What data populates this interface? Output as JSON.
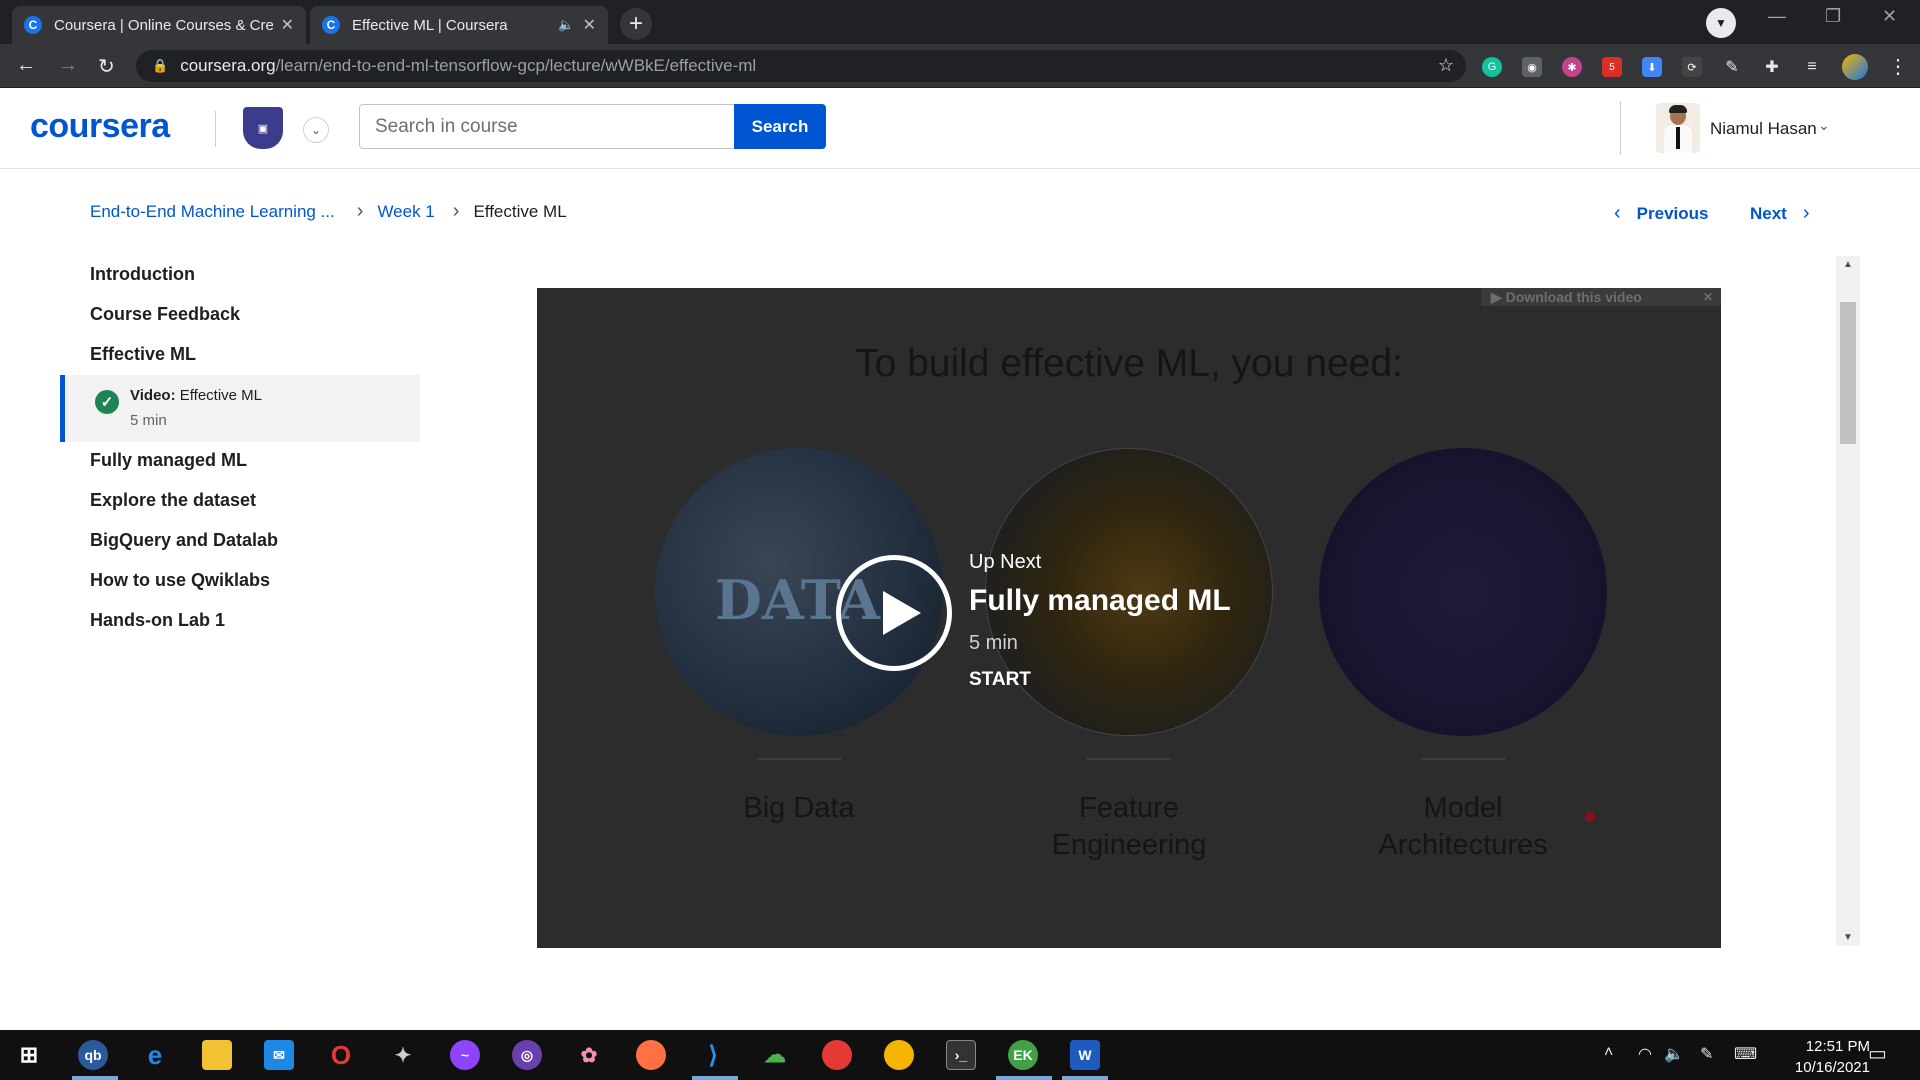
{
  "browser": {
    "tabs": [
      {
        "label": "Coursera | Online Courses & Credentials",
        "favicon": "C"
      },
      {
        "label": "Effective ML | Coursera",
        "favicon": "C"
      }
    ],
    "url_host": "coursera.org",
    "url_path": "/learn/end-to-end-ml-tensorflow-gcp/lecture/wWBkE/effective-ml",
    "extension_badge": "5"
  },
  "header": {
    "logo": "coursera",
    "search_placeholder": "Search in course",
    "search_button": "Search",
    "username": "Niamul Hasan"
  },
  "breadcrumb": {
    "course": "End-to-End Machine Learning ...",
    "week": "Week 1",
    "current": "Effective ML",
    "previous": "Previous",
    "next": "Next"
  },
  "sidebar": {
    "items": [
      "Introduction",
      "Course Feedback",
      "Effective ML",
      "Fully managed ML",
      "Explore the dataset",
      "BigQuery and Datalab",
      "How to use Qwiklabs",
      "Hands-on Lab 1"
    ],
    "active_item": {
      "type_label": "Video:",
      "title": "Effective ML",
      "duration": "5 min"
    }
  },
  "video": {
    "download_label": "Download this video",
    "slide_title": "To build effective ML, you need:",
    "circle_text": "DATA",
    "captions": [
      {
        "line1": "Big Data",
        "line2": ""
      },
      {
        "line1": "Feature",
        "line2": "Engineering"
      },
      {
        "line1": "Model",
        "line2": "Architectures"
      }
    ],
    "up_next": {
      "label": "Up Next",
      "title": "Fully managed ML",
      "duration": "5 min",
      "start": "START"
    }
  },
  "taskbar": {
    "time": "12:51 PM",
    "date": "10/16/2021",
    "apps": [
      "windows-start",
      "gb",
      "edge",
      "file-explorer",
      "mail",
      "opera",
      "satellite",
      "messenger",
      "github",
      "pinwheel",
      "firefox",
      "vscode",
      "cloud-app",
      "chrome",
      "chrome-profile",
      "terminal",
      "chrome-ek",
      "word"
    ]
  },
  "colors": {
    "brand": "#0056d2",
    "success": "#1f8354",
    "chrome_dark": "#202124",
    "video_bg": "#2c2c2c"
  }
}
